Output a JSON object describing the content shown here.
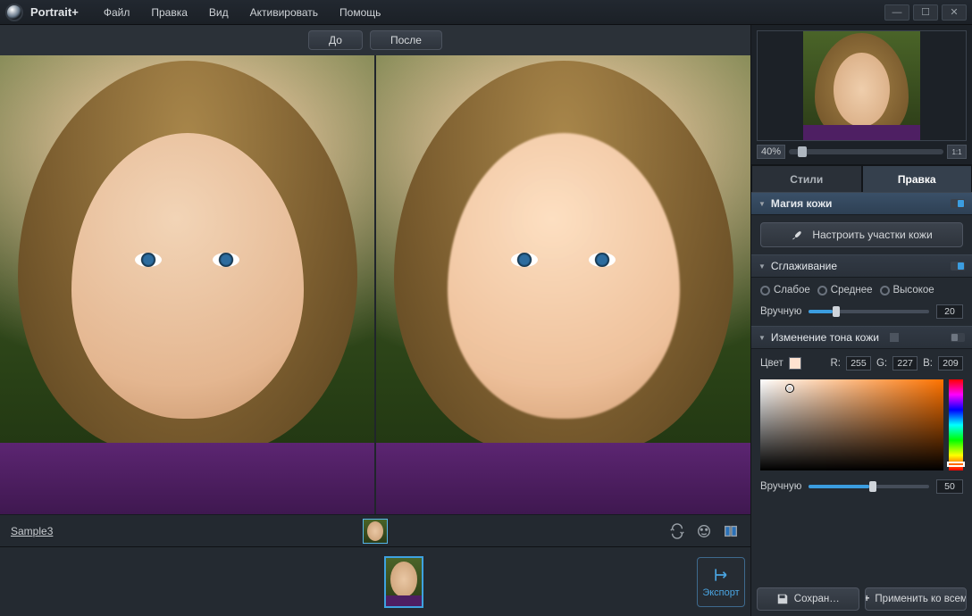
{
  "app": {
    "title": "Portrait+"
  },
  "menu": {
    "file": "Файл",
    "edit": "Правка",
    "view": "Вид",
    "activate": "Активировать",
    "help": "Помощь"
  },
  "compare": {
    "before": "До",
    "after": "После"
  },
  "document": {
    "name": "Sample3"
  },
  "navigator": {
    "zoom": "40%"
  },
  "tabs": {
    "styles": "Стили",
    "edit": "Правка"
  },
  "skin_magic": {
    "title": "Магия кожи",
    "configure_btn": "Настроить участки кожи"
  },
  "smoothing": {
    "title": "Сглаживание",
    "options": {
      "weak": "Слабое",
      "medium": "Среднее",
      "strong": "Высокое"
    },
    "manual_label": "Вручную",
    "manual_value": "20"
  },
  "skin_tone": {
    "title": "Изменение тона кожи",
    "color_label": "Цвет",
    "r_label": "R:",
    "r": "255",
    "g_label": "G:",
    "g": "227",
    "b_label": "B:",
    "b": "209",
    "manual_label": "Вручную",
    "manual_value": "50"
  },
  "actions": {
    "save": "Сохран…",
    "apply_all": "Применить ко всем",
    "export": "Экспорт"
  }
}
